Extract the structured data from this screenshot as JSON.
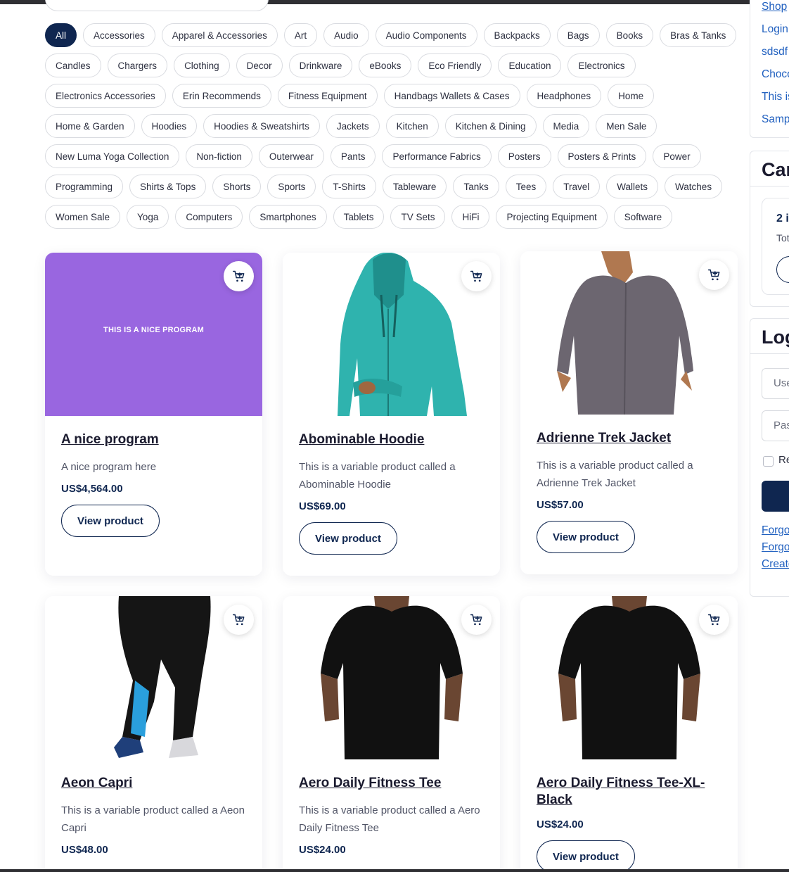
{
  "filters": {
    "rows": [
      [
        "All",
        "Accessories",
        "Apparel & Accessories",
        "Art",
        "Audio",
        "Audio Components",
        "Backpacks",
        "Bags",
        "Books",
        "Bras & Tanks"
      ],
      [
        "Candles",
        "Chargers",
        "Clothing",
        "Decor",
        "Drinkware",
        "eBooks",
        "Eco Friendly",
        "Education",
        "Electronics"
      ],
      [
        "Electronics Accessories",
        "Erin Recommends",
        "Fitness Equipment",
        "Handbags Wallets & Cases",
        "Headphones",
        "Home"
      ],
      [
        "Home & Garden",
        "Hoodies",
        "Hoodies & Sweatshirts",
        "Jackets",
        "Kitchen",
        "Kitchen & Dining",
        "Media",
        "Men Sale"
      ],
      [
        "New Luma Yoga Collection",
        "Non-fiction",
        "Outerwear",
        "Pants",
        "Performance Fabrics",
        "Posters",
        "Posters & Prints",
        "Power"
      ],
      [
        "Programming",
        "Shirts & Tops",
        "Shorts",
        "Sports",
        "T-Shirts",
        "Tableware",
        "Tanks",
        "Tees",
        "Travel",
        "Wallets",
        "Watches"
      ],
      [
        "Women Sale",
        "Yoga",
        "Computers",
        "Smartphones",
        "Tablets",
        "TV Sets",
        "HiFi",
        "Projecting Equipment",
        "Software"
      ]
    ],
    "active": "All"
  },
  "products": [
    {
      "title": "A nice program",
      "desc": "A nice program here",
      "price": "US$4,564.00",
      "button": "View product",
      "image": "promo",
      "promo_text": "THIS IS A NICE PROGRAM",
      "promo_color": "#9966e0"
    },
    {
      "title": "Abominable Hoodie",
      "desc": "This is a variable product called a Abominable Hoodie",
      "price": "US$69.00",
      "button": "View product",
      "image": "hoodie"
    },
    {
      "title": "Adrienne Trek Jacket",
      "desc": "This is a variable product called a Adrienne Trek Jacket",
      "price": "US$57.00",
      "button": "View product",
      "image": "jacket"
    },
    {
      "title": "Aeon Capri",
      "desc": "This is a variable product called a Aeon Capri",
      "price": "US$48.00",
      "button": "View product",
      "image": "capri"
    },
    {
      "title": "Aero Daily Fitness Tee",
      "desc": "This is a variable product called a Aero Daily Fitness Tee",
      "price": "US$24.00",
      "button": "View product",
      "image": "tee"
    },
    {
      "title": "Aero Daily Fitness Tee-XL-Black",
      "desc": "",
      "price": "US$24.00",
      "button": "View product",
      "image": "tee"
    }
  ],
  "sidebar": {
    "links": [
      "Shop",
      "Login",
      "sdsdf",
      "Choco",
      "This is",
      "Samp"
    ],
    "cart": {
      "title": "Car",
      "count": "2 i",
      "total": "Tot"
    },
    "login": {
      "title": "Log",
      "username_placeholder": "Use",
      "password_placeholder": "Pas",
      "remember": "Re",
      "links": [
        "Forgo",
        "Forgo",
        "Create"
      ]
    }
  },
  "colors": {
    "primary": "#0f2650",
    "link": "#1f5fbf",
    "hoodie": "#2fb3ae",
    "jacket": "#6c6670",
    "promo": "#9966e0"
  }
}
